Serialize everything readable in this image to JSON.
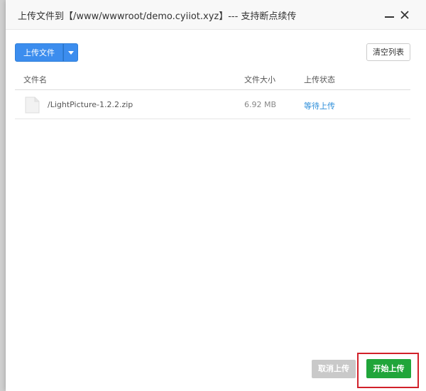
{
  "dialog": {
    "title": "上传文件到【/www/wwwroot/demo.cyiiot.xyz】--- 支持断点续传",
    "upload_button_label": "上传文件",
    "clear_button_label": "清空列表",
    "cancel_button_label": "取消上传",
    "start_button_label": "开始上传"
  },
  "table": {
    "headers": {
      "name": "文件名",
      "size": "文件大小",
      "status": "上传状态"
    },
    "rows": [
      {
        "name": "/LightPicture-1.2.2.zip",
        "size": "6.92 MB",
        "status": "等待上传"
      }
    ]
  },
  "colors": {
    "primary_blue": "#3c8dee",
    "start_green": "#20a53a",
    "status_link": "#2b8dd9",
    "highlight_red": "#d1212a"
  },
  "icons": [
    "minimize-icon",
    "close-icon",
    "caret-down-icon",
    "file-icon"
  ]
}
